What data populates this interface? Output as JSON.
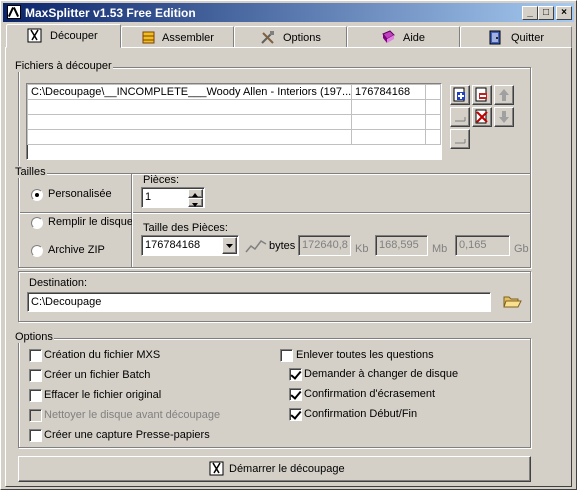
{
  "window": {
    "title": "MaxSplitter v1.53 Free Edition"
  },
  "caption_buttons": {
    "minimize": "_",
    "maximize": "□",
    "close": "×"
  },
  "tabs": [
    {
      "label": "Découper",
      "active": true
    },
    {
      "label": "Assembler",
      "active": false
    },
    {
      "label": "Options",
      "active": false
    },
    {
      "label": "Aide",
      "active": false
    },
    {
      "label": "Quitter",
      "active": false
    }
  ],
  "files_group": {
    "legend": "Fichiers à découper",
    "rows": [
      {
        "path": "C:\\Decoupage\\__INCOMPLETE___Woody Allen - Interiors (197...",
        "size": "176784168"
      }
    ]
  },
  "sizes_group": {
    "legend": "Tailles",
    "radios": [
      {
        "label": "Personalisée",
        "selected": true
      },
      {
        "label": "Remplir le disque",
        "selected": false
      },
      {
        "label": "Archive ZIP",
        "selected": false
      }
    ],
    "pieces_label": "Pièces:",
    "pieces_value": "1",
    "piece_size_label": "Taille des Pièces:",
    "piece_size_value": "176784168",
    "bytes_label": "bytes",
    "kb_value": "172640,8",
    "kb_unit": "Kb",
    "mb_value": "168,595",
    "mb_unit": "Mb",
    "gb_value": "0,165",
    "gb_unit": "Gb"
  },
  "destination": {
    "label": "Destination:",
    "value": "C:\\Decoupage"
  },
  "options_group": {
    "legend": "Options",
    "left": [
      {
        "label": "Création du fichier MXS",
        "checked": false,
        "enabled": true
      },
      {
        "label": "Créer un fichier Batch",
        "checked": false,
        "enabled": true
      },
      {
        "label": "Effacer le fichier original",
        "checked": false,
        "enabled": true
      },
      {
        "label": "Nettoyer le disque avant découpage",
        "checked": false,
        "enabled": false
      },
      {
        "label": "Créer une capture Presse-papiers",
        "checked": false,
        "enabled": true
      }
    ],
    "right": [
      {
        "label": "Enlever toutes les questions",
        "checked": false
      },
      {
        "label": "Demander à changer de disque",
        "checked": true
      },
      {
        "label": "Confirmation d'écrasement",
        "checked": true
      },
      {
        "label": "Confirmation Début/Fin",
        "checked": true
      }
    ]
  },
  "start_button": {
    "label": "Démarrer le découpage"
  },
  "colors": {
    "face": "#d4d0c8",
    "title_start": "#0a246a",
    "title_end": "#a6caf0"
  }
}
